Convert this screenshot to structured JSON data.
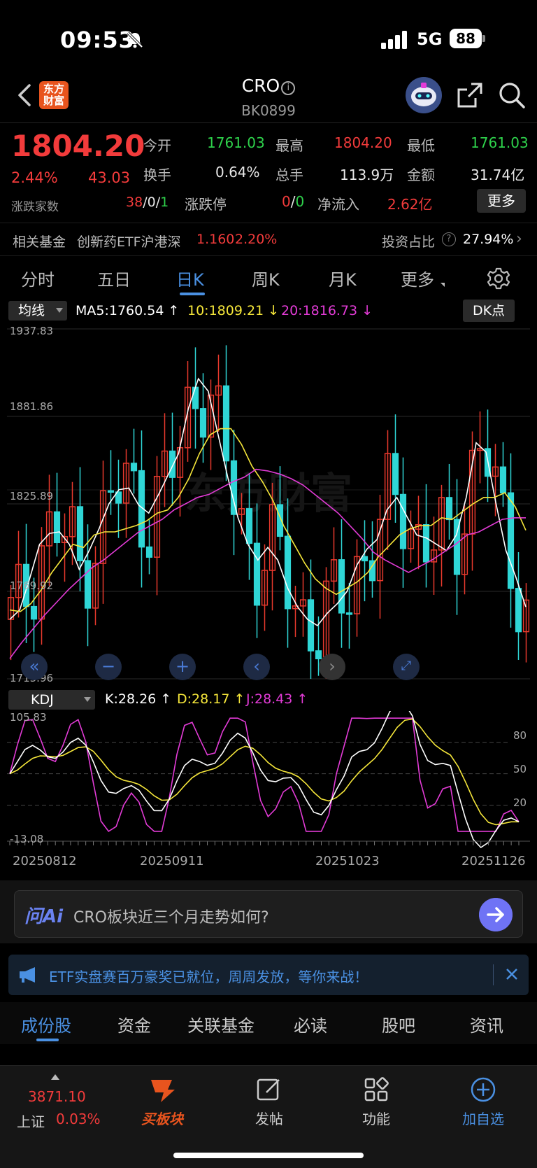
{
  "status_bar": {
    "time": "09:53",
    "network": "5G",
    "battery": "88"
  },
  "header": {
    "title": "CRO",
    "code": "BK0899",
    "logo_text": "东方财富"
  },
  "quote": {
    "price": "1804.20",
    "change_pct": "2.44%",
    "change": "43.03",
    "rise_fall_label": "涨跌家数",
    "rise": "38",
    "flat": "0",
    "fall": "1",
    "fields": [
      {
        "label": "今开",
        "value": "1761.03",
        "color": "green"
      },
      {
        "label": "最高",
        "value": "1804.20",
        "color": "red"
      },
      {
        "label": "最低",
        "value": "1761.03",
        "color": "green"
      },
      {
        "label": "换手",
        "value": "0.64%",
        "color": "white"
      },
      {
        "label": "总手",
        "value": "113.9万",
        "color": "white"
      },
      {
        "label": "金额",
        "value": "31.74亿",
        "color": "white"
      },
      {
        "label": "涨跌停",
        "value_up": "0",
        "value_down": "0"
      },
      {
        "label": "净流入",
        "value": "2.62亿",
        "color": "red"
      }
    ],
    "more_button": "更多"
  },
  "fund_row": {
    "label": "相关基金",
    "fund_name": "创新药ETF沪港深",
    "fund_price": "1.160",
    "fund_pct": "2.20%",
    "ratio_label": "投资占比",
    "ratio_value": "27.94%"
  },
  "k_tabs": [
    {
      "label": "分时"
    },
    {
      "label": "五日"
    },
    {
      "label": "日K",
      "active": true
    },
    {
      "label": "周K"
    },
    {
      "label": "月K"
    },
    {
      "label": "更多"
    }
  ],
  "ma_bar": {
    "selector": "均线",
    "ma5": "MA5:1760.54",
    "ma10": "10:1809.21",
    "ma20": "20:1816.73",
    "dk_button": "DK点",
    "colors": {
      "ma5": "#ffffff",
      "ma10": "#f5e63a",
      "ma20": "#e23bd6",
      "up": "#e8392d",
      "down": "#2fd6d6"
    }
  },
  "chart_data": [
    {
      "type": "candlestick",
      "title": "",
      "y_ticks": [
        "1937.83",
        "1881.86",
        "1825.89",
        "1769.92",
        "1713.96"
      ],
      "ylim": [
        1713.96,
        1937.83
      ],
      "x_labels": [
        "20250812",
        "20250911",
        "20251023",
        "20251126"
      ],
      "series": [
        {
          "name": "MA5",
          "values": [
            1752,
            1758,
            1778,
            1800,
            1807,
            1808,
            1800,
            1784,
            1796,
            1810,
            1826,
            1835,
            1836,
            1825,
            1820,
            1832,
            1845,
            1858,
            1887,
            1906,
            1898,
            1870,
            1842,
            1817,
            1800,
            1790,
            1798,
            1790,
            1772,
            1760,
            1752,
            1748,
            1756,
            1762,
            1770,
            1787,
            1797,
            1803,
            1822,
            1830,
            1818,
            1806,
            1804,
            1800,
            1796,
            1806,
            1830,
            1865,
            1859,
            1826,
            1796,
            1779,
            1760
          ]
        },
        {
          "name": "MA10",
          "values": [
            1758,
            1757,
            1762,
            1771,
            1782,
            1791,
            1800,
            1798,
            1806,
            1808,
            1808,
            1810,
            1812,
            1815,
            1820,
            1822,
            1830,
            1842,
            1858,
            1870,
            1874,
            1874,
            1864,
            1850,
            1840,
            1828,
            1812,
            1800,
            1788,
            1778,
            1772,
            1768,
            1772,
            1776,
            1782,
            1792,
            1799,
            1806,
            1810,
            1812,
            1812,
            1817,
            1816,
            1821,
            1826,
            1830,
            1830,
            1833,
            1824,
            1809
          ]
        },
        {
          "name": "MA20",
          "values": [
            1727,
            1737,
            1746,
            1755,
            1763,
            1771,
            1778,
            1785,
            1790,
            1796,
            1802,
            1808,
            1812,
            1816,
            1822,
            1826,
            1830,
            1832,
            1836,
            1840,
            1843,
            1848,
            1847,
            1845,
            1842,
            1838,
            1832,
            1826,
            1820,
            1812,
            1804,
            1795,
            1790,
            1786,
            1782,
            1786,
            1790,
            1795,
            1800,
            1806,
            1808,
            1812,
            1816,
            1817,
            1817
          ]
        }
      ]
    },
    {
      "type": "line",
      "title": "KDJ",
      "y_ticks": [
        "105.83",
        "-13.08"
      ],
      "right_ticks": [
        "80",
        "50",
        "20"
      ],
      "ylim": [
        -13.08,
        105.83
      ],
      "series": [
        {
          "name": "K",
          "current": "K:28.26"
        },
        {
          "name": "D",
          "current": "D:28.17"
        },
        {
          "name": "J",
          "current": "J:28.43"
        }
      ]
    }
  ],
  "kdj_bar": {
    "selector": "KDJ",
    "k": "K:28.26",
    "d": "D:28.17",
    "j": "J:28.43"
  },
  "ai": {
    "logo": "问Ai",
    "prompt": "CRO板块近三个月走势如何?"
  },
  "banner": {
    "text": "ETF实盘赛百万豪奖已就位，周周发放，等你来战！"
  },
  "bottom_tabs": [
    {
      "label": "成份股",
      "active": true
    },
    {
      "label": "资金"
    },
    {
      "label": "关联基金"
    },
    {
      "label": "必读"
    },
    {
      "label": "股吧"
    },
    {
      "label": "资讯"
    }
  ],
  "bottom_nav": {
    "index_value": "3871.10",
    "index_name": "上证",
    "index_pct": "0.03%",
    "items": [
      {
        "label": "买板块"
      },
      {
        "label": "发帖"
      },
      {
        "label": "功能"
      },
      {
        "label": "加自选"
      }
    ]
  }
}
